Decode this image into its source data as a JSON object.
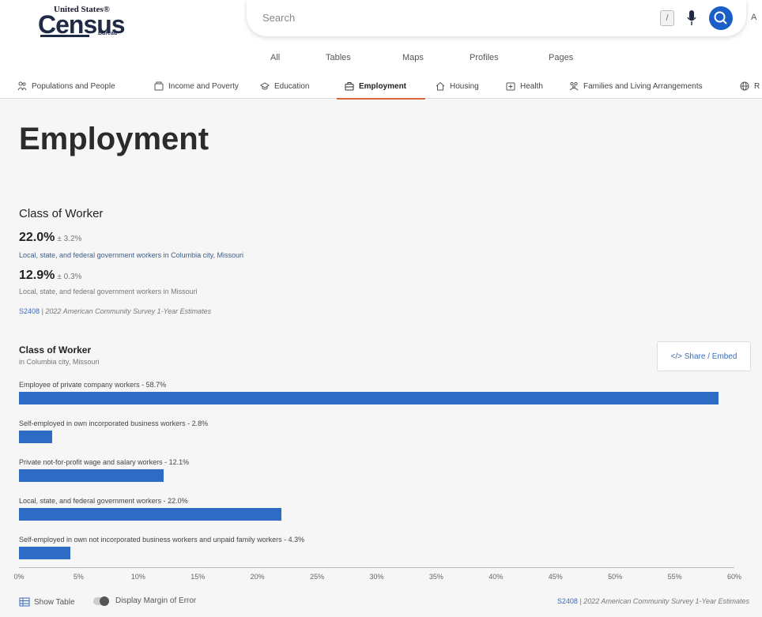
{
  "header": {
    "logo_top": "United States®",
    "logo_main": "Census",
    "logo_bureau": "Bureau",
    "search_placeholder": "Search",
    "slash_key": "/",
    "account_label": "A",
    "scope_tabs": [
      "All",
      "Tables",
      "Maps",
      "Profiles",
      "Pages"
    ]
  },
  "topics": [
    {
      "label": "Populations and People",
      "icon": "people-icon"
    },
    {
      "label": "Income and Poverty",
      "icon": "wallet-icon"
    },
    {
      "label": "Education",
      "icon": "graduation-cap-icon"
    },
    {
      "label": "Employment",
      "icon": "briefcase-icon"
    },
    {
      "label": "Housing",
      "icon": "house-icon"
    },
    {
      "label": "Health",
      "icon": "health-icon"
    },
    {
      "label": "Families and Living Arrangements",
      "icon": "family-icon"
    },
    {
      "label": "R",
      "icon": "globe-icon"
    }
  ],
  "page": {
    "title": "Employment"
  },
  "class_of_worker": {
    "title": "Class of Worker",
    "stat1_value": "22.0%",
    "stat1_moe": "± 3.2%",
    "stat1_desc": "Local, state, and federal government workers in Columbia city, Missouri",
    "stat2_value": "12.9%",
    "stat2_moe": "± 0.3%",
    "stat2_desc": "Local, state, and federal government workers in Missouri",
    "source_code": "S2408",
    "source_text": "2022 American Community Survey 1-Year Estimates"
  },
  "chart_meta": {
    "title": "Class of Worker",
    "subtitle": "in Columbia city, Missouri",
    "share_label": "</> Share / Embed",
    "show_table": "Show Table",
    "margin_toggle": "Display Margin of Error",
    "source_code": "S2408",
    "source_text": "2022 American Community Survey 1-Year Estimates"
  },
  "chart_data": {
    "type": "bar",
    "orientation": "horizontal",
    "title": "Class of Worker",
    "subtitle": "in Columbia city, Missouri",
    "categories": [
      "Employee of private company workers",
      "Self-employed in own incorporated business workers",
      "Private not-for-profit wage and salary workers",
      "Local, state, and federal government workers",
      "Self-employed in own not incorporated business workers and unpaid family workers"
    ],
    "labels": [
      "Employee of private company workers - 58.7%",
      "Self-employed in own incorporated business workers - 2.8%",
      "Private not-for-profit wage and salary workers - 12.1%",
      "Local, state, and federal government workers - 22.0%",
      "Self-employed in own not incorporated business workers and unpaid family workers - 4.3%"
    ],
    "values": [
      58.7,
      2.8,
      12.1,
      22.0,
      4.3
    ],
    "xlim": [
      0,
      60
    ],
    "xticks": [
      "0%",
      "5%",
      "10%",
      "15%",
      "20%",
      "25%",
      "30%",
      "35%",
      "40%",
      "45%",
      "50%",
      "55%",
      "60%"
    ],
    "bar_color": "#2e6bc4",
    "grid": false
  },
  "colors": {
    "accent": "#1a5ec8",
    "bar": "#2e6bc4",
    "active_underline": "#d9653b",
    "link": "#3a6bb8"
  }
}
